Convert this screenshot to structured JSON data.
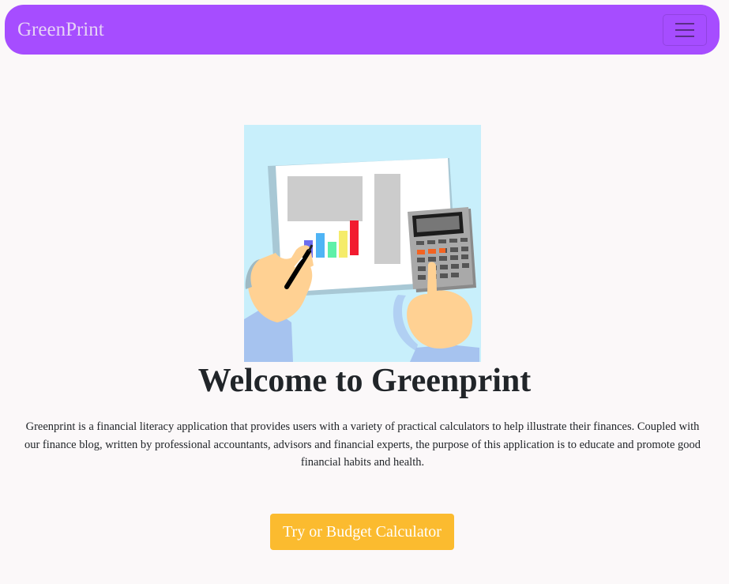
{
  "navbar": {
    "brand": "GreenPrint",
    "menu_icon": "hamburger-menu-icon",
    "accent_color": "#a64dff"
  },
  "hero": {
    "image": "finance-illustration-calculator-chart"
  },
  "main": {
    "title": "Welcome to Greenprint",
    "description": "Greenprint is a financial literacy application that provides users with a variety of practical calculators to help illustrate their finances. Coupled with our finance blog, written by professional accountants, advisors and financial experts, the purpose of this application is to educate and promote good financial habits and health.",
    "cta_label": "Try or Budget Calculator",
    "cta_color": "#fbbb2f"
  }
}
